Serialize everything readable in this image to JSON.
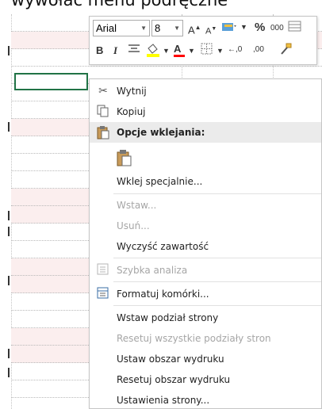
{
  "caption": "wywołać menu podręczne",
  "mini_toolbar": {
    "font_name": "Arial",
    "font_size": "8",
    "grow_font": "A˄",
    "shrink_font": "A˅",
    "percent": "%",
    "thousands": "000",
    "bold": "B",
    "italic": "I",
    "increase_decimal": "←,0",
    "decrease_decimal": ",00",
    "font_color_letter": "A"
  },
  "menu": {
    "cut": "Wytnij",
    "copy": "Kopiuj",
    "paste_options": "Opcje wklejania:",
    "paste_special": "Wklej specjalnie...",
    "insert": "Wstaw...",
    "delete": "Usuń...",
    "clear_contents": "Wyczyść zawartość",
    "quick_analysis": "Szybka analiza",
    "format_cells": "Formatuj komórki...",
    "insert_page_break": "Wstaw podział strony",
    "reset_page_breaks": "Resetuj wszystkie podziały stron",
    "set_print_area": "Ustaw obszar wydruku",
    "reset_print_area": "Resetuj obszar wydruku",
    "page_setup": "Ustawienia strony..."
  },
  "colors": {
    "selection_border": "#217346",
    "highlight_yellow": "#ffff00",
    "font_red": "#ff0000",
    "menu_header_bg": "#ebebeb",
    "pink_row": "#fbeeee"
  }
}
